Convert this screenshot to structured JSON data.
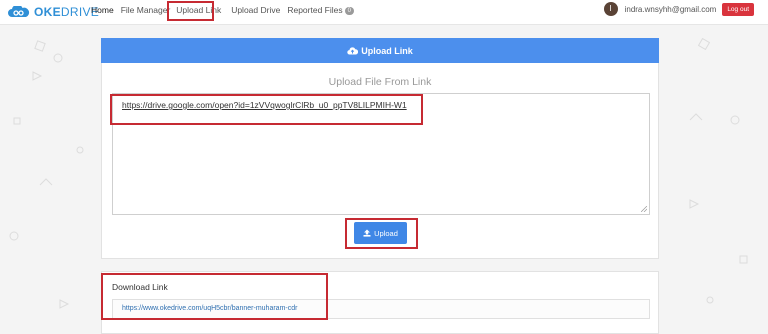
{
  "brand": {
    "name_part1": "OKE",
    "name_part2": "DRIVE",
    "color": "#2f8fd6"
  },
  "nav": {
    "home": "Home",
    "file_manager": "File Manager",
    "upload_link": "Upload Link",
    "upload_drive": "Upload Drive",
    "reported_files": "Reported Files",
    "reported_count": "0"
  },
  "user": {
    "avatar_initial": "I",
    "email": "indra.wnsyhh@gmail.com",
    "logout_label": "Log out"
  },
  "upload_card": {
    "header": "Upload Link",
    "subtitle": "Upload File From Link",
    "link_value": "https://drive.google.com/open?id=1zVVqwoglrClRb_u0_ppTV8LILPMIH-W1",
    "upload_button": "Upload",
    "accent": "#4c8fed"
  },
  "download_card": {
    "title": "Download Link",
    "link": "https://www.okedrive.com/uqH5cbr/banner-muharam-cdr"
  },
  "highlight_color": "#c62a32"
}
